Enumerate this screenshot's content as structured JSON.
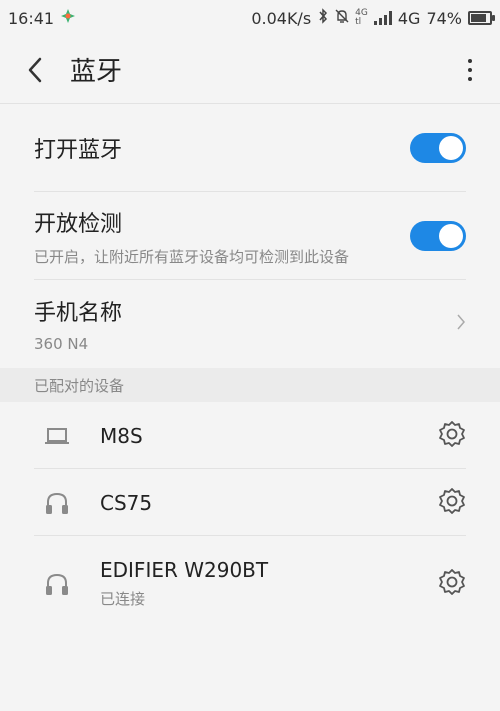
{
  "status_bar": {
    "time": "16:41",
    "net_speed": "0.04K/s",
    "lte_top": "4G",
    "lte_bottom": "tl",
    "network": "4G",
    "battery": "74%",
    "battery_level": 0.74
  },
  "header": {
    "title": "蓝牙"
  },
  "settings": {
    "bluetooth_label": "打开蓝牙",
    "bluetooth_on": true,
    "discoverable_label": "开放检测",
    "discoverable_desc": "已开启，让附近所有蓝牙设备均可检测到此设备",
    "discoverable_on": true,
    "device_name_label": "手机名称",
    "device_name_value": "360 N4"
  },
  "paired": {
    "header": "已配对的设备",
    "devices": [
      {
        "name": "M8S",
        "icon": "laptop-icon",
        "status": ""
      },
      {
        "name": "CS75",
        "icon": "headphones-icon",
        "status": ""
      },
      {
        "name": "EDIFIER W290BT",
        "icon": "headphones-icon",
        "status": "已连接"
      }
    ]
  },
  "colors": {
    "accent": "#1e88e5",
    "icon_gray": "#8a8a8a"
  }
}
